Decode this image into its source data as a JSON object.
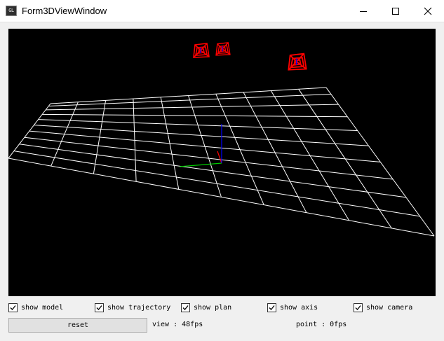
{
  "window": {
    "title": "Form3DViewWindow",
    "app_icon": "GL",
    "controls": {
      "minimize_icon": "minimize-icon",
      "maximize_icon": "maximize-icon",
      "close_icon": "close-icon"
    }
  },
  "viewport": {
    "background": "#000000",
    "grid_color": "#ffffff",
    "camera_color": "#ff0000",
    "axis_colors": {
      "x": "#ff0000",
      "y": "#00cc00",
      "z": "#0000ff"
    },
    "cameras_shown": 3
  },
  "options": [
    {
      "label": "show model",
      "checked": true
    },
    {
      "label": "show trajectory",
      "checked": true
    },
    {
      "label": "show plan",
      "checked": true
    },
    {
      "label": "show axis",
      "checked": true
    },
    {
      "label": "show camera",
      "checked": true
    }
  ],
  "controls": {
    "reset_label": "reset",
    "view_fps": "view : 48fps",
    "point_fps": "point : 0fps"
  }
}
